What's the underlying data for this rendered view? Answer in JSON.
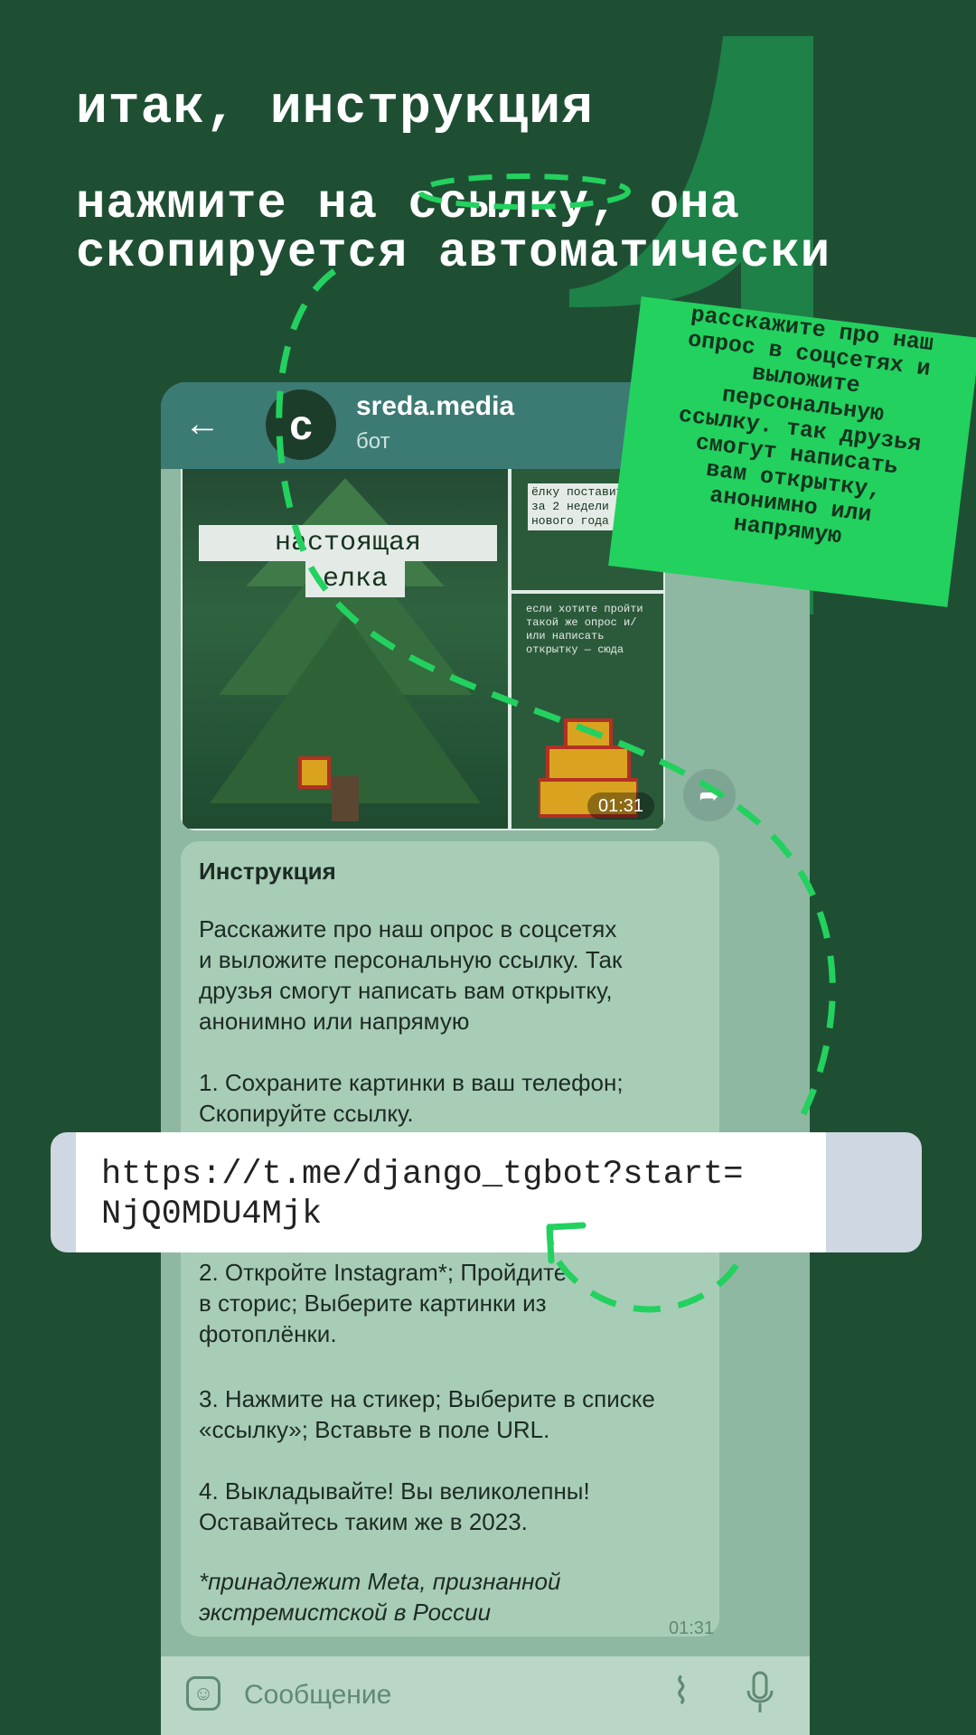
{
  "headline": "итак, инструкция",
  "subline": [
    "нажмите на ссылку, она",
    "скопируется автоматически"
  ],
  "sticky_note": [
    "расскажите про наш",
    "опрос в соцсетях и",
    "выложите",
    "персональную",
    "ссылку. так друзья",
    "смогут написать",
    "вам открытку,",
    "анонимно или",
    "напрямую"
  ],
  "chat": {
    "name": "sreda.media",
    "subtitle": "бот",
    "avatar_letter": "c"
  },
  "media": {
    "tag_line1": "настоящая",
    "tag_line2": "елка",
    "right_top_text": "ёлку поставить за 2 недели до нового года",
    "right_bottom_text": "если хотите пройти такой же опрос и/или написать открытку — сюда",
    "duration": "01:31"
  },
  "message": {
    "title": "Инструкция",
    "intro": "Расскажите про наш опрос в соцсетях\nи выложите персональную ссылку. Так\nдрузья смогут написать вам открытку,\nанонимно или напрямую",
    "step1": "1. Сохраните картинки в ваш телефон;\nСкопируйте ссылку.",
    "step2": "2. Откройте Instagram*; Пройдите\nв сторис; Выберите картинки из\nфотоплёнки.",
    "step3": "3. Нажмите на стикер; Выберите в списке\n«ссылку»; Вставьте в поле URL.",
    "step4": "4. Выкладывайте! Вы великолепны!\nОставайтесь таким же в 2023.",
    "footnote": "*принадлежит Meta, признанной\nэкстремистской в России",
    "time": "01:31"
  },
  "link": [
    "https://t.me/django_tgbot?start=",
    "NjQ0MDU4Mjk"
  ],
  "input": {
    "placeholder": "Сообщение"
  },
  "colors": {
    "background": "#1f4f33",
    "accent_green": "#23d15f",
    "bubble": "#a8cdb7",
    "topbar": "#3c7a74"
  },
  "icons": [
    "back-arrow-icon",
    "share-icon",
    "sticker-icon",
    "paperclip-icon",
    "microphone-icon"
  ]
}
